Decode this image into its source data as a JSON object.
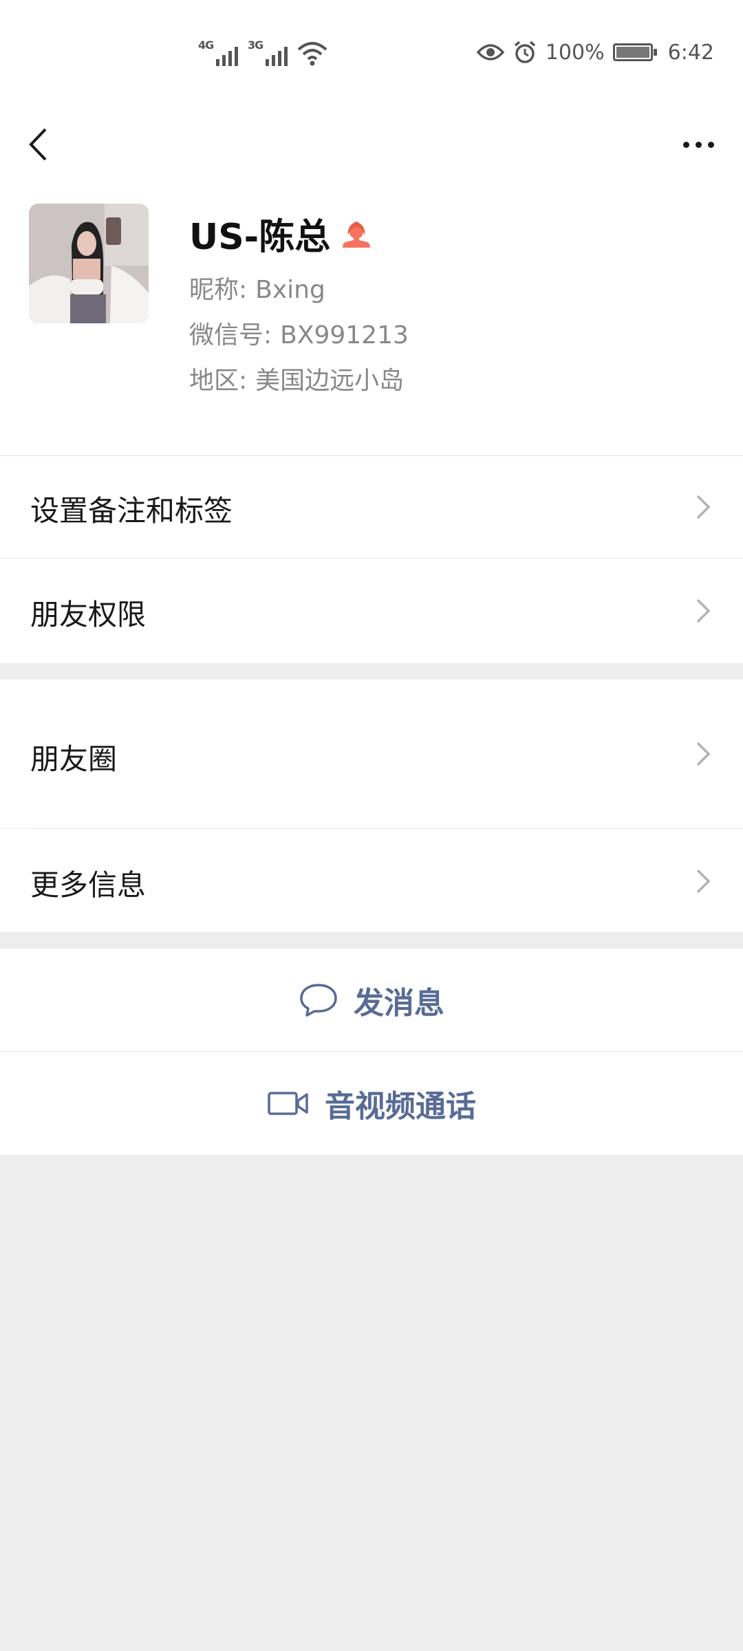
{
  "status_bar": {
    "network_1": "4G",
    "network_2": "3G",
    "battery_percent": "100%",
    "time": "6:42",
    "icons": [
      "wifi-icon",
      "eye-icon",
      "alarm-icon",
      "battery-icon"
    ]
  },
  "nav": {
    "back_icon": "back-arrow-icon",
    "more_icon": "more-dots-icon"
  },
  "profile": {
    "name": "US-陈总",
    "gender_icon": "female-icon",
    "gender_color": "#f5735f",
    "nickname_label": "昵称:",
    "nickname": "Bxing",
    "wechat_id_label": "微信号:",
    "wechat_id": "BX991213",
    "region_label": "地区:",
    "region": "美国边远小岛"
  },
  "menu": {
    "remark": "设置备注和标签",
    "permissions": "朋友权限",
    "moments": "朋友圈",
    "more_info": "更多信息"
  },
  "actions": {
    "message": "发消息",
    "call": "音视频通话",
    "link_color": "#576b95"
  }
}
